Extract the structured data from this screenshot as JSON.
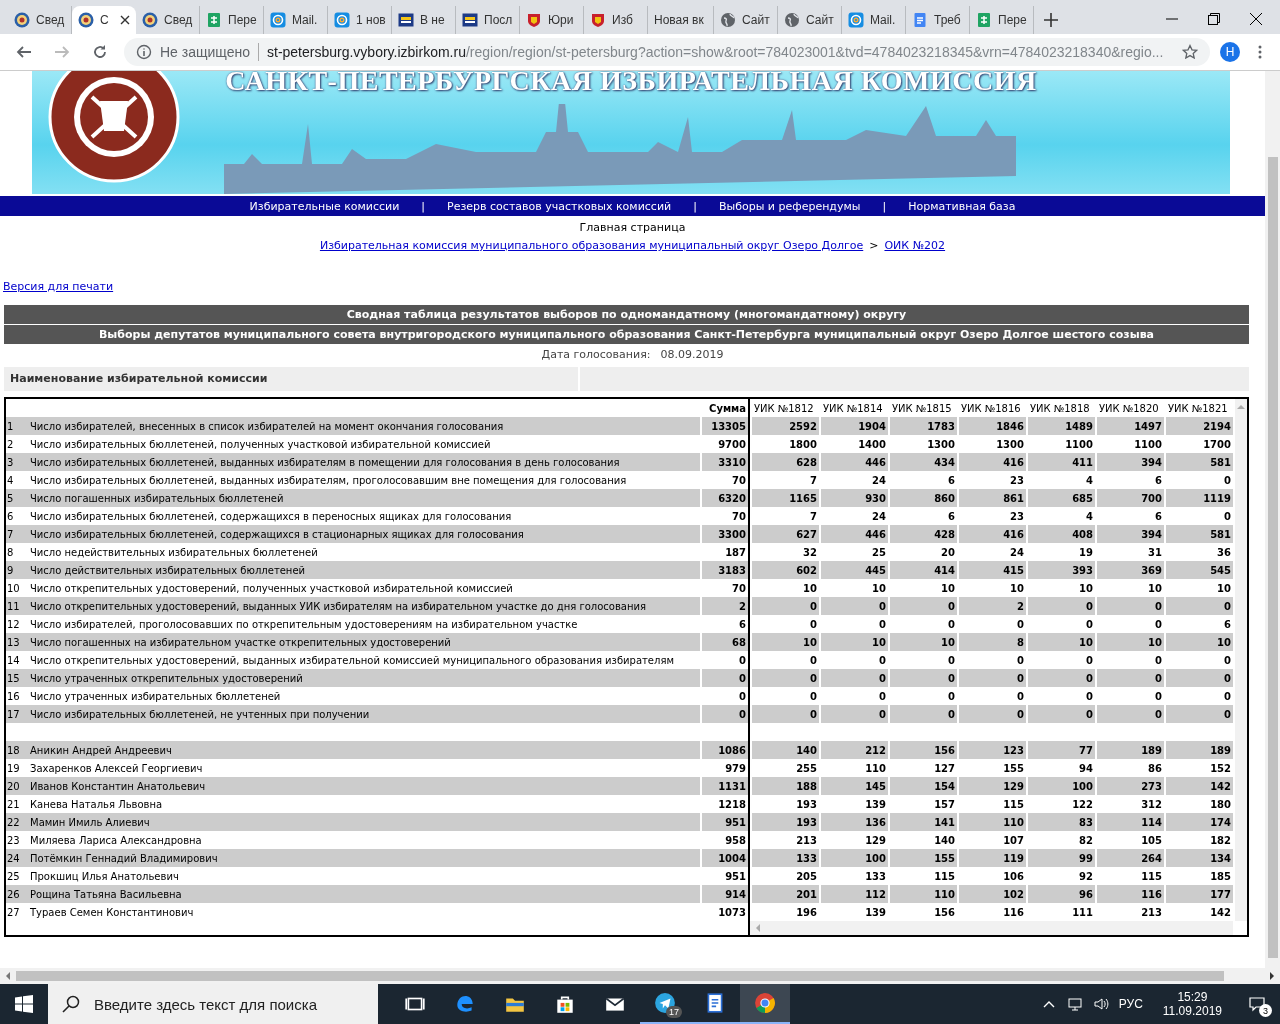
{
  "browser_tabs": [
    {
      "title": "Свед",
      "kind": "emblem",
      "selected": false
    },
    {
      "title": "С",
      "kind": "emblem",
      "selected": true
    },
    {
      "title": "Свед",
      "kind": "emblem",
      "selected": false
    },
    {
      "title": "Пере",
      "kind": "sheet",
      "selected": false
    },
    {
      "title": "Mail.",
      "kind": "mail",
      "selected": false
    },
    {
      "title": "1 нов",
      "kind": "mail",
      "selected": false
    },
    {
      "title": "В не",
      "kind": "card",
      "selected": false
    },
    {
      "title": "Посл",
      "kind": "card",
      "selected": false
    },
    {
      "title": "Юри",
      "kind": "crest",
      "selected": false
    },
    {
      "title": "Изб",
      "kind": "crest",
      "selected": false
    },
    {
      "title": "Новая вк",
      "kind": "blank",
      "selected": false
    },
    {
      "title": "Сайт",
      "kind": "globe",
      "selected": false
    },
    {
      "title": "Сайт",
      "kind": "globe",
      "selected": false
    },
    {
      "title": "Mail.",
      "kind": "mail",
      "selected": false
    },
    {
      "title": "Треб",
      "kind": "doc",
      "selected": false
    },
    {
      "title": "Пере",
      "kind": "sheet",
      "selected": false
    }
  ],
  "address_bar": {
    "security": "Не защищено",
    "host": "st-petersburg.vybory.izbirkom.ru",
    "path": "/region/region/st-petersburg?action=show&root=784023001&tvd=4784023218345&vrn=4784023218340&regio...",
    "profile": "Н"
  },
  "banner": {
    "title": "САНКТ-ПЕТЕРБУРГСКАЯ ИЗБИРАТЕЛЬНАЯ КОМИССИЯ"
  },
  "nav": [
    "Избирательные комиссии",
    "Резерв составов участковых комиссий",
    "Выборы и референдумы",
    "Нормативная база"
  ],
  "nav_separator": "|",
  "home": "Главная страница",
  "breadcrumbs": [
    "Избирательная комиссия муниципального образования муниципальный округ Озеро Долгое",
    "ОИК №202"
  ],
  "breadcrumb_separator": ">",
  "print_link": "Версия для печати",
  "titles": [
    "Сводная таблица результатов выборов по одномандатному (многомандатному) округу",
    "Выборы депутатов муниципального совета внутригородского муниципального образования Санкт-Петербурга муниципальный округ Озеро Долгое шестого созыва"
  ],
  "date_label": "Дата голосования:",
  "date": "08.09.2019",
  "commission_header": "Наименование избирательной комиссии",
  "table": {
    "sum_header": "Сумма",
    "columns": [
      "УИК №1812",
      "УИК №1814",
      "УИК №1815",
      "УИК №1816",
      "УИК №1818",
      "УИК №1820",
      "УИК №1821"
    ],
    "groups": [
      {
        "rows": [
          {
            "n": "1",
            "label": "Число избирателей, внесенных в список избирателей на момент окончания голосования",
            "sum": "13305",
            "values": [
              "2592",
              "1904",
              "1783",
              "1846",
              "1489",
              "1497",
              "2194"
            ]
          },
          {
            "n": "2",
            "label": "Число избирательных бюллетеней, полученных участковой избирательной комиссией",
            "sum": "9700",
            "values": [
              "1800",
              "1400",
              "1300",
              "1300",
              "1100",
              "1100",
              "1700"
            ]
          },
          {
            "n": "3",
            "label": "Число избирательных бюллетеней, выданных избирателям в помещении для голосования в день голосования",
            "sum": "3310",
            "values": [
              "628",
              "446",
              "434",
              "416",
              "411",
              "394",
              "581"
            ]
          },
          {
            "n": "4",
            "label": "Число избирательных бюллетеней, выданных избирателям, проголосовавшим вне помещения для голосования",
            "sum": "70",
            "values": [
              "7",
              "24",
              "6",
              "23",
              "4",
              "6",
              "0"
            ]
          },
          {
            "n": "5",
            "label": "Число погашенных избирательных бюллетеней",
            "sum": "6320",
            "values": [
              "1165",
              "930",
              "860",
              "861",
              "685",
              "700",
              "1119"
            ]
          },
          {
            "n": "6",
            "label": "Число избирательных бюллетеней, содержащихся в переносных ящиках для голосования",
            "sum": "70",
            "values": [
              "7",
              "24",
              "6",
              "23",
              "4",
              "6",
              "0"
            ]
          },
          {
            "n": "7",
            "label": "Число избирательных бюллетеней, содержащихся в стационарных ящиках для голосования",
            "sum": "3300",
            "values": [
              "627",
              "446",
              "428",
              "416",
              "408",
              "394",
              "581"
            ]
          },
          {
            "n": "8",
            "label": "Число недействительных избирательных бюллетеней",
            "sum": "187",
            "values": [
              "32",
              "25",
              "20",
              "24",
              "19",
              "31",
              "36"
            ]
          },
          {
            "n": "9",
            "label": "Число действительных избирательных бюллетеней",
            "sum": "3183",
            "values": [
              "602",
              "445",
              "414",
              "415",
              "393",
              "369",
              "545"
            ]
          },
          {
            "n": "10",
            "label": "Число открепительных удостоверений, полученных участковой избирательной комиссией",
            "sum": "70",
            "values": [
              "10",
              "10",
              "10",
              "10",
              "10",
              "10",
              "10"
            ]
          },
          {
            "n": "11",
            "label": "Число открепительных удостоверений, выданных УИК избирателям на избирательном участке до дня голосования",
            "sum": "2",
            "values": [
              "0",
              "0",
              "0",
              "2",
              "0",
              "0",
              "0"
            ]
          },
          {
            "n": "12",
            "label": "Число избирателей, проголосовавших по открепительным удостоверениям на избирательном участке",
            "sum": "6",
            "values": [
              "0",
              "0",
              "0",
              "0",
              "0",
              "0",
              "6"
            ]
          },
          {
            "n": "13",
            "label": "Число погашенных на избирательном участке открепительных удостоверений",
            "sum": "68",
            "values": [
              "10",
              "10",
              "10",
              "8",
              "10",
              "10",
              "10"
            ]
          },
          {
            "n": "14",
            "label": "Число открепительных удостоверений, выданных избирательной комиссией муниципального образования избирателям",
            "sum": "0",
            "values": [
              "0",
              "0",
              "0",
              "0",
              "0",
              "0",
              "0"
            ]
          },
          {
            "n": "15",
            "label": "Число утраченных открепительных удостоверений",
            "sum": "0",
            "values": [
              "0",
              "0",
              "0",
              "0",
              "0",
              "0",
              "0"
            ]
          },
          {
            "n": "16",
            "label": "Число утраченных избирательных бюллетеней",
            "sum": "0",
            "values": [
              "0",
              "0",
              "0",
              "0",
              "0",
              "0",
              "0"
            ]
          },
          {
            "n": "17",
            "label": "Число избирательных бюллетеней, не учтенных при получении",
            "sum": "0",
            "values": [
              "0",
              "0",
              "0",
              "0",
              "0",
              "0",
              "0"
            ]
          }
        ]
      },
      {
        "rows": [
          {
            "n": "18",
            "label": "Аникин Андрей Андреевич",
            "sum": "1086",
            "values": [
              "140",
              "212",
              "156",
              "123",
              "77",
              "189",
              "189"
            ]
          },
          {
            "n": "19",
            "label": "Захаренков Алексей Георгиевич",
            "sum": "979",
            "values": [
              "255",
              "110",
              "127",
              "155",
              "94",
              "86",
              "152"
            ]
          },
          {
            "n": "20",
            "label": "Иванов Константин Анатольевич",
            "sum": "1131",
            "values": [
              "188",
              "145",
              "154",
              "129",
              "100",
              "273",
              "142"
            ]
          },
          {
            "n": "21",
            "label": "Канева Наталья Львовна",
            "sum": "1218",
            "values": [
              "193",
              "139",
              "157",
              "115",
              "122",
              "312",
              "180"
            ]
          },
          {
            "n": "22",
            "label": "Мамин Имиль Алиевич",
            "sum": "951",
            "values": [
              "193",
              "136",
              "141",
              "110",
              "83",
              "114",
              "174"
            ]
          },
          {
            "n": "23",
            "label": "Миляева Лариса Александровна",
            "sum": "958",
            "values": [
              "213",
              "129",
              "140",
              "107",
              "82",
              "105",
              "182"
            ]
          },
          {
            "n": "24",
            "label": "Потёмкин Геннадий Владимирович",
            "sum": "1004",
            "values": [
              "133",
              "100",
              "155",
              "119",
              "99",
              "264",
              "134"
            ]
          },
          {
            "n": "25",
            "label": "Прокшиц Илья Анатольевич",
            "sum": "951",
            "values": [
              "205",
              "133",
              "115",
              "106",
              "92",
              "115",
              "185"
            ]
          },
          {
            "n": "26",
            "label": "Рощина Татьяна Васильевна",
            "sum": "914",
            "values": [
              "201",
              "112",
              "110",
              "102",
              "96",
              "116",
              "177"
            ]
          },
          {
            "n": "27",
            "label": "Тураев Семен Константинович",
            "sum": "1073",
            "values": [
              "196",
              "139",
              "156",
              "116",
              "111",
              "213",
              "142"
            ]
          }
        ]
      }
    ]
  },
  "taskbar": {
    "search_placeholder": "Введите здесь текст для поиска",
    "apps": [
      {
        "kind": "task-view",
        "running": false,
        "active": false
      },
      {
        "kind": "edge",
        "running": false,
        "active": false
      },
      {
        "kind": "folder",
        "running": false,
        "active": false
      },
      {
        "kind": "store",
        "running": false,
        "active": false
      },
      {
        "kind": "mail",
        "running": false,
        "active": false
      },
      {
        "kind": "telegram",
        "running": true,
        "active": false,
        "badge": "17"
      },
      {
        "kind": "doc",
        "running": true,
        "active": false
      },
      {
        "kind": "chrome",
        "running": true,
        "active": true
      }
    ],
    "language": "РУС",
    "time": "15:29",
    "date": "11.09.2019",
    "notifications": "3"
  }
}
